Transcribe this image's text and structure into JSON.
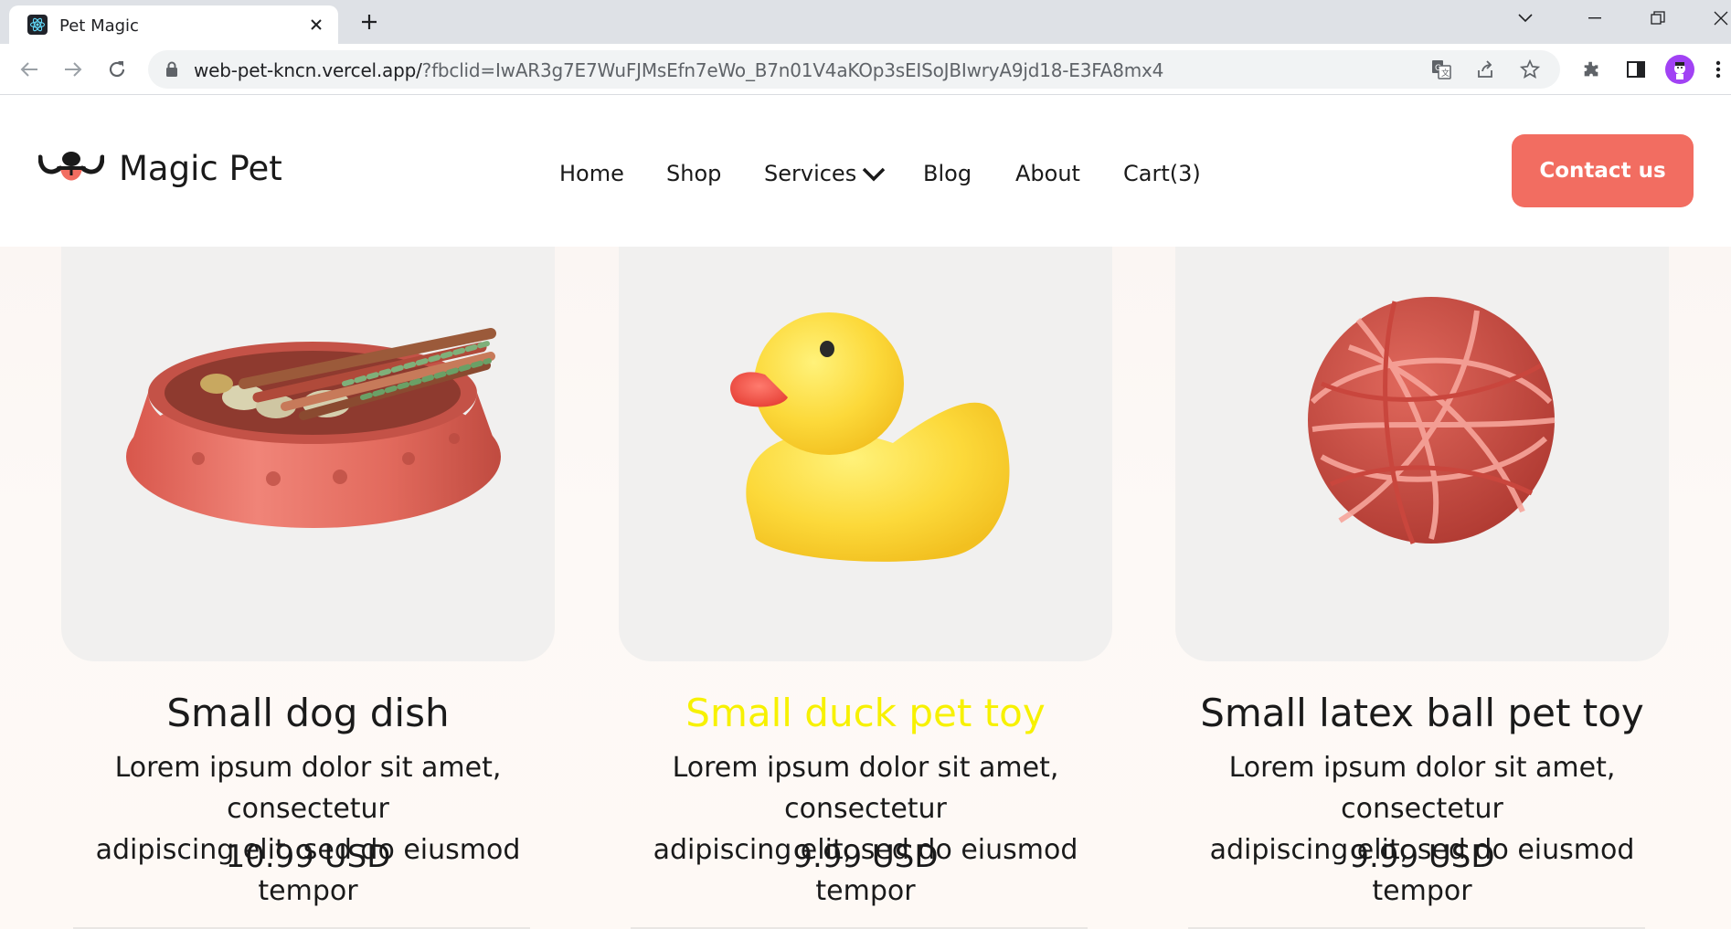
{
  "browser": {
    "tab_title": "Pet Magic",
    "url_host": "web-pet-kncn.vercel.app/",
    "url_rest": "?fbclid=IwAR3g7E7WuFJMsEfn7eWo_B7n01V4aKOp3sEISoJBIwryA9jd18-E3FA8mx4",
    "icons": [
      "react-favicon-icon",
      "close-icon",
      "plus-icon",
      "chevron-down-icon",
      "minimize-icon",
      "restore-icon",
      "window-close-icon",
      "back-icon",
      "forward-icon",
      "reload-icon",
      "lock-icon",
      "translate-icon",
      "share-icon",
      "star-icon",
      "extensions-icon",
      "side-panel-icon",
      "profile-avatar",
      "more-icon"
    ]
  },
  "header": {
    "logo_text": "Magic Pet",
    "nav": [
      "Home",
      "Shop",
      "Services",
      "Blog",
      "About",
      "Cart(3)"
    ],
    "contact_label": "Contact us",
    "accent_color": "#f26d61"
  },
  "products": [
    {
      "title": "Small dog dish",
      "desc_line1": "Lorem ipsum dolor sit amet, consectetur",
      "desc_line2": "adipiscing elit, sed do eiusmod tempor",
      "price": "10.99 USD",
      "image": "dog-dish"
    },
    {
      "title": "Small duck pet toy",
      "desc_line1": "Lorem ipsum dolor sit amet, consectetur",
      "desc_line2": "adipiscing elit, sed do eiusmod tempor",
      "price": "9.99 USD",
      "image": "rubber-duck",
      "title_color": "#f7f100"
    },
    {
      "title": "Small latex ball pet toy",
      "desc_line1": "Lorem ipsum dolor sit amet, consectetur",
      "desc_line2": "adipiscing elit, sed do eiusmod tempor",
      "price": "9.99 USD",
      "image": "rubber-band-ball"
    }
  ]
}
